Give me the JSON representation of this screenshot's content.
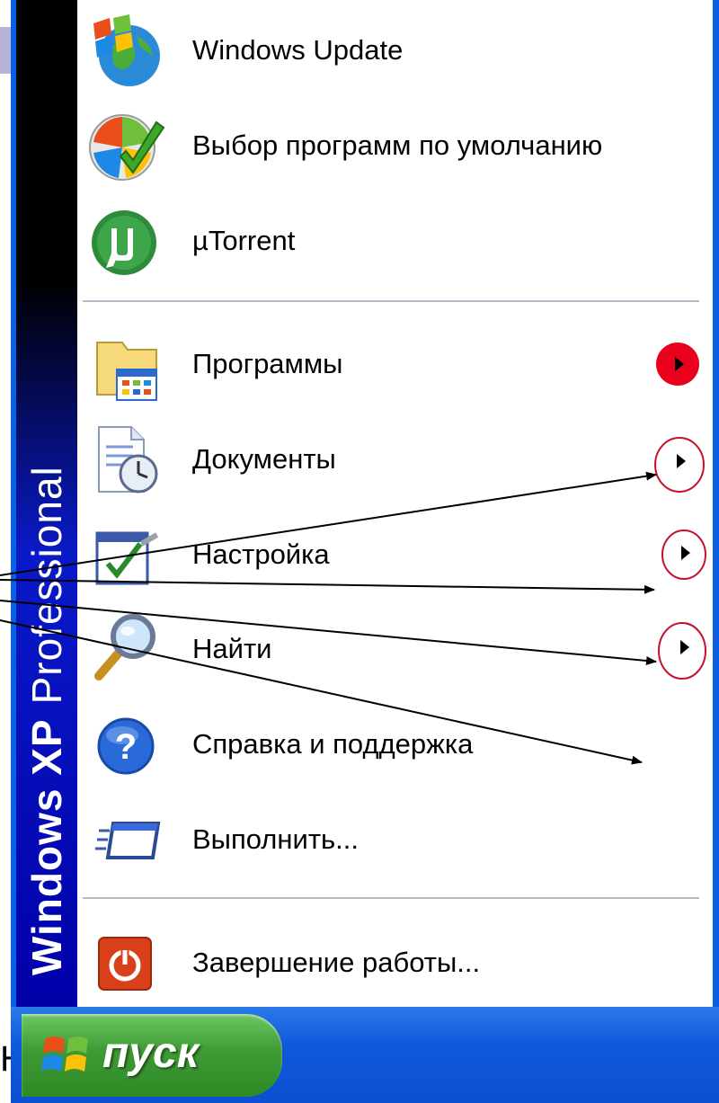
{
  "slide": {
    "partial_letter": "Н"
  },
  "start_menu": {
    "side_banner": {
      "brand": "Windows XP",
      "edition": "Professional"
    },
    "pinned": [
      {
        "label": "Windows Update",
        "icon": "windows-update-globe-icon"
      },
      {
        "label": "Выбор программ по умолчанию",
        "icon": "default-programs-icon"
      },
      {
        "label": "µTorrent",
        "icon": "utorrent-icon"
      }
    ],
    "items": [
      {
        "label": "Программы",
        "icon": "programs-folder-icon",
        "has_submenu": true,
        "highlight": "filled"
      },
      {
        "label": "Документы",
        "icon": "documents-icon",
        "has_submenu": true,
        "highlight": "circled"
      },
      {
        "label": "Настройка",
        "icon": "settings-icon",
        "has_submenu": true,
        "highlight": "circled"
      },
      {
        "label": "Найти",
        "icon": "search-magnifier-icon",
        "has_submenu": true,
        "highlight": "circled"
      },
      {
        "label": "Справка и поддержка",
        "icon": "help-icon",
        "has_submenu": false
      },
      {
        "label": "Выполнить...",
        "icon": "run-icon",
        "has_submenu": false
      }
    ],
    "shutdown": {
      "label": "Завершение работы...",
      "icon": "power-icon"
    }
  },
  "taskbar": {
    "start_label": "пуск",
    "start_icon": "windows-flag-icon"
  },
  "colors": {
    "taskbar_blue": "#0a50d0",
    "start_green": "#3e9a34",
    "highlight_red": "#e8001c",
    "circle_red": "#c8102e"
  }
}
